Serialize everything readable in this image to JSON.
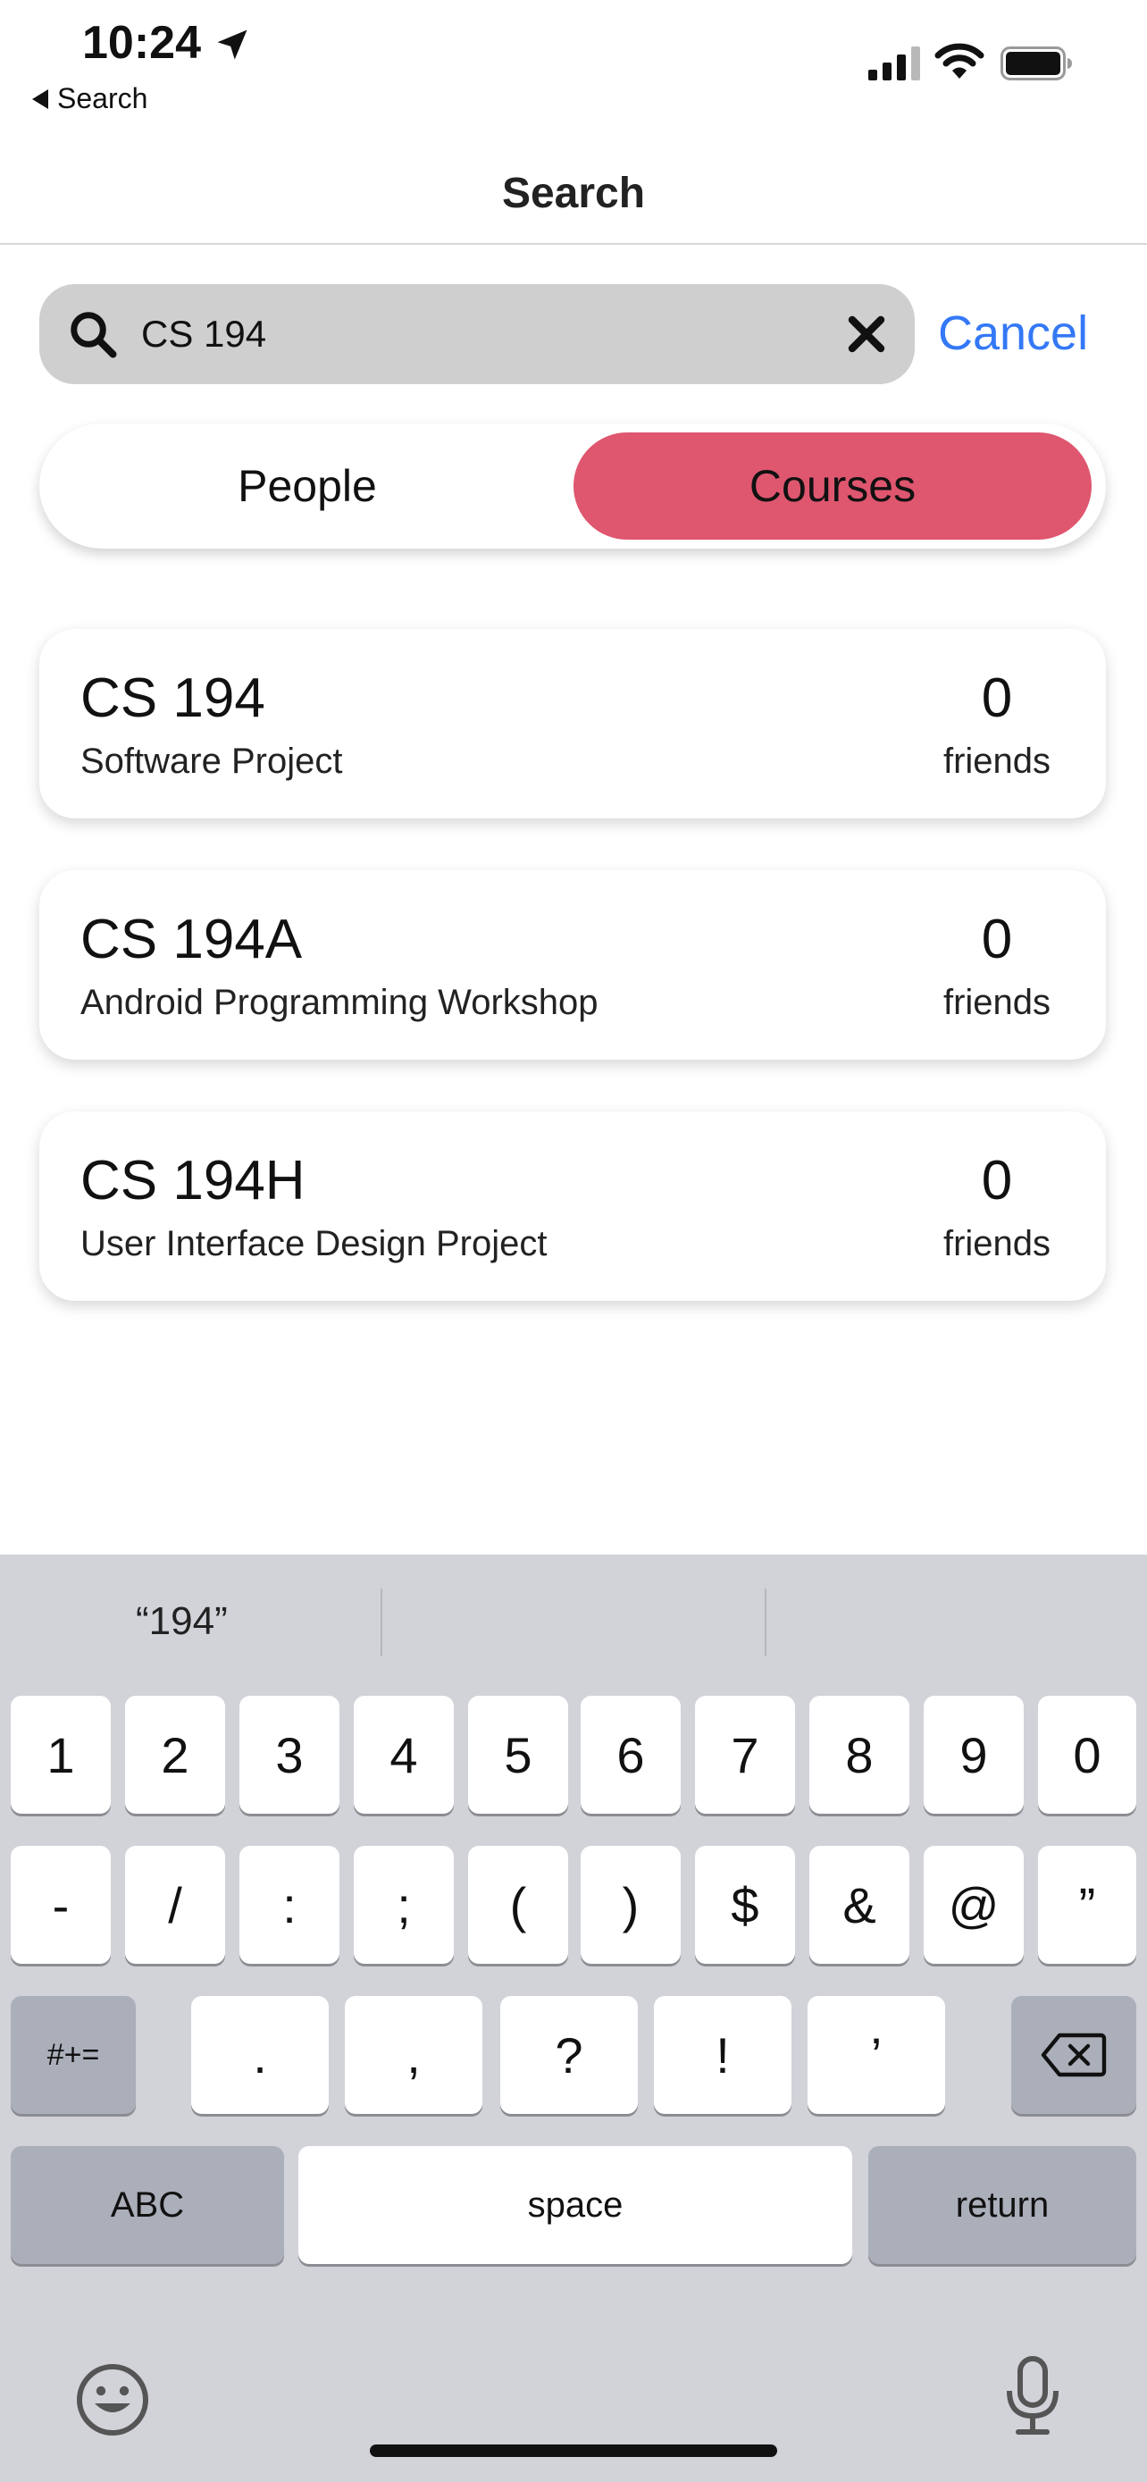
{
  "status_bar": {
    "time": "10:24",
    "back_app_label": "Search",
    "icons": [
      "location-arrow-icon",
      "signal-icon",
      "wifi-icon",
      "battery-icon"
    ]
  },
  "nav": {
    "title": "Search"
  },
  "search": {
    "value": "CS 194",
    "placeholder": "",
    "cancel_label": "Cancel"
  },
  "segmented": {
    "people_label": "People",
    "courses_label": "Courses",
    "selected": "Courses",
    "accent_color": "#df566f"
  },
  "courses": [
    {
      "code": "CS 194",
      "name": "Software Project",
      "friends_count": "0",
      "friends_label": "friends"
    },
    {
      "code": "CS 194A",
      "name": "Android Programming Workshop",
      "friends_count": "0",
      "friends_label": "friends"
    },
    {
      "code": "CS 194H",
      "name": "User Interface Design Project",
      "friends_count": "0",
      "friends_label": "friends"
    }
  ],
  "keyboard": {
    "suggestions": [
      "“194”",
      "",
      ""
    ],
    "row1": [
      "1",
      "2",
      "3",
      "4",
      "5",
      "6",
      "7",
      "8",
      "9",
      "0"
    ],
    "row2": [
      "-",
      "/",
      ":",
      ";",
      "(",
      ")",
      "$",
      "&",
      "@",
      "”"
    ],
    "row3_toggle": "#+=",
    "row3": [
      ".",
      ",",
      "?",
      "!",
      "’"
    ],
    "abc_label": "ABC",
    "space_label": "space",
    "return_label": "return",
    "delete_icon": "delete-backspace-icon",
    "emoji_icon": "emoji-icon",
    "mic_icon": "microphone-icon"
  },
  "colors": {
    "link": "#3478f6",
    "search_bg": "#cfcfcf",
    "keyboard_bg": "#d1d3d9"
  }
}
